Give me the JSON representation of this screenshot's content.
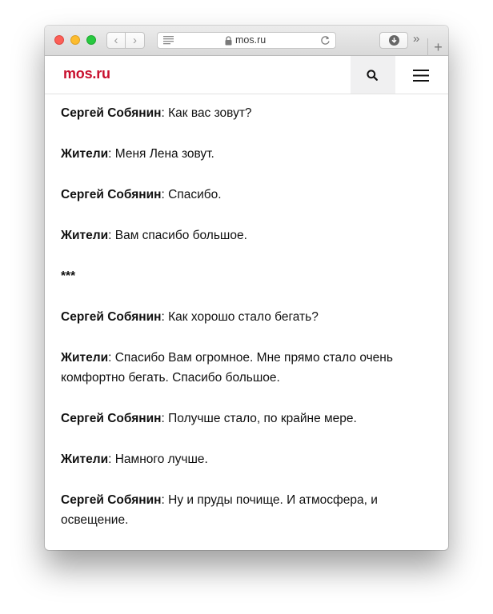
{
  "browser": {
    "url": "mos.ru",
    "more_label": "»",
    "new_tab_label": "+"
  },
  "site": {
    "logo": "mos.ru",
    "brand_color": "#c8102e"
  },
  "dialogue": [
    {
      "speaker": "Сергей Собянин",
      "text": ": Как вас зовут?"
    },
    {
      "speaker": "Жители",
      "text": ": Меня Лена зовут."
    },
    {
      "speaker": "Сергей Собянин",
      "text": ": Спасибо."
    },
    {
      "speaker": "Жители",
      "text": ": Вам спасибо большое."
    },
    {
      "speaker": "***",
      "text": ""
    },
    {
      "speaker": "Сергей Собянин",
      "text": ": Как хорошо стало бегать?"
    },
    {
      "speaker": "Жители",
      "text": ": Спасибо Вам огромное. Мне прямо стало очень комфортно бегать. Спасибо большое."
    },
    {
      "speaker": "Сергей Собянин",
      "text": ": Получше стало, по крайне мере."
    },
    {
      "speaker": "Жители",
      "text": ": Намного лучше."
    },
    {
      "speaker": "Сергей Собянин",
      "text": ": Ну и пруды почище. И атмосфера, и освещение."
    }
  ]
}
